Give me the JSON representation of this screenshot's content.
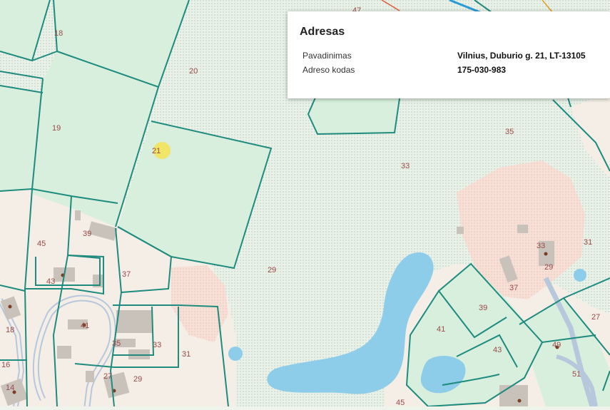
{
  "popup": {
    "title": "Adresas",
    "rows": [
      {
        "label": "Pavadinimas",
        "value": "Vilnius, Duburio g. 21, LT-13105"
      },
      {
        "label": "Adreso kodas",
        "value": "175-030-983"
      }
    ]
  },
  "map": {
    "colors": {
      "parcel_stroke": "#1e8b7e",
      "green_area": "#d7efdc",
      "dotted_area": "#e6efe5",
      "residential": "#f5efe8",
      "pink_area": "#f7dcd4",
      "water": "#8ecdea",
      "highlight": "#f4e35a"
    },
    "plot_labels": [
      "47",
      "18",
      "20",
      "19",
      "21",
      "33",
      "35",
      "31",
      "45",
      "39",
      "37",
      "43",
      "29",
      "41",
      "18",
      "33",
      "31",
      "16",
      "14",
      "27",
      "29",
      "35",
      "37",
      "39",
      "41",
      "43",
      "49",
      "51",
      "45",
      "27",
      "33",
      "29"
    ]
  }
}
